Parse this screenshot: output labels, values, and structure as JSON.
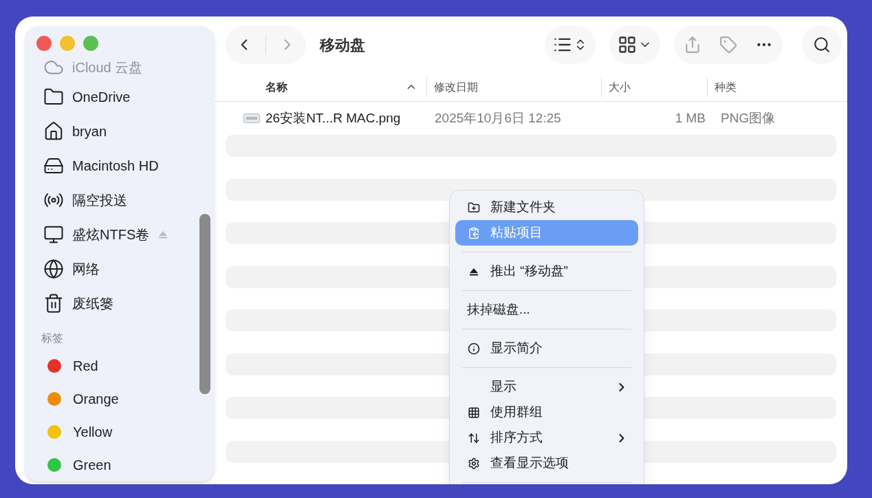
{
  "window": {
    "title": "移动盘"
  },
  "sidebar": {
    "items": [
      {
        "label": "iCloud 云盘",
        "faded": true
      },
      {
        "label": "OneDrive",
        "faded": false
      },
      {
        "label": "bryan",
        "faded": false
      },
      {
        "label": "Macintosh HD",
        "faded": false
      },
      {
        "label": "隔空投送",
        "faded": false
      },
      {
        "label": "盛炫NTFS卷",
        "faded": false,
        "ejectable": true
      },
      {
        "label": "网络",
        "faded": false
      },
      {
        "label": "废纸篓",
        "faded": false
      }
    ],
    "tags_heading": "标签",
    "tags": [
      {
        "label": "Red",
        "color": "#e8302b"
      },
      {
        "label": "Orange",
        "color": "#ee8a0c"
      },
      {
        "label": "Yellow",
        "color": "#f0c30f"
      },
      {
        "label": "Green",
        "color": "#2fc645"
      }
    ]
  },
  "table": {
    "columns": [
      {
        "label": "名称",
        "sorted": true
      },
      {
        "label": "修改日期",
        "sorted": false
      },
      {
        "label": "大小",
        "sorted": false
      },
      {
        "label": "种类",
        "sorted": false
      }
    ],
    "rows": [
      {
        "name": "26安装NT...R MAC.png",
        "date": "2025年10月6日 12:25",
        "size": "1 MB",
        "kind": "PNG图像"
      }
    ]
  },
  "context_menu": [
    {
      "kind": "item",
      "label": "新建文件夹",
      "selected": false,
      "submenu": false
    },
    {
      "kind": "item",
      "label": "粘贴项目",
      "selected": true,
      "submenu": false
    },
    {
      "kind": "separator"
    },
    {
      "kind": "item",
      "label": "推出 “移动盘”",
      "selected": false,
      "submenu": false
    },
    {
      "kind": "separator"
    },
    {
      "kind": "item",
      "label": "抹掉磁盘...",
      "selected": false,
      "submenu": false
    },
    {
      "kind": "separator"
    },
    {
      "kind": "item",
      "label": "显示简介",
      "selected": false,
      "submenu": false
    },
    {
      "kind": "separator"
    },
    {
      "kind": "item",
      "label": "显示",
      "selected": false,
      "submenu": true
    },
    {
      "kind": "item",
      "label": "使用群组",
      "selected": false,
      "submenu": false
    },
    {
      "kind": "item",
      "label": "排序方式",
      "selected": false,
      "submenu": true
    },
    {
      "kind": "item",
      "label": "查看显示选项",
      "selected": false,
      "submenu": false
    },
    {
      "kind": "separator"
    }
  ]
}
